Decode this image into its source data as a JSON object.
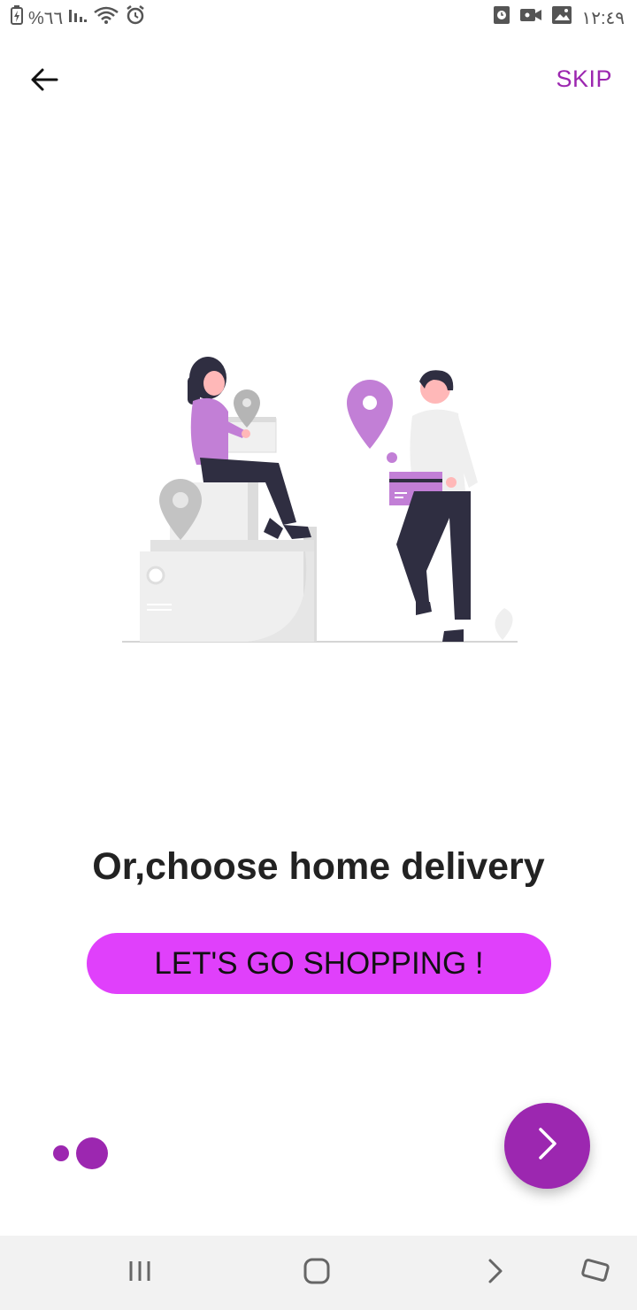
{
  "status_bar": {
    "battery_text": "%٦٦",
    "time": "١٢:٤٩"
  },
  "header": {
    "back_icon": "arrow-left-icon",
    "skip_label": "SKIP"
  },
  "content": {
    "headline": "Or,choose home delivery",
    "cta_label": "LET'S GO SHOPPING !"
  },
  "pager": {
    "total_pages": 2,
    "current_page": 2
  },
  "fab": {
    "icon": "chevron-right-icon"
  },
  "nav_bar": {
    "items": [
      "recent-apps-icon",
      "home-icon",
      "back-icon",
      "rotate-icon"
    ]
  },
  "colors": {
    "accent": "#9c27b0",
    "cta_background": "#e040fb",
    "illustration_purple": "#c27fd6"
  }
}
